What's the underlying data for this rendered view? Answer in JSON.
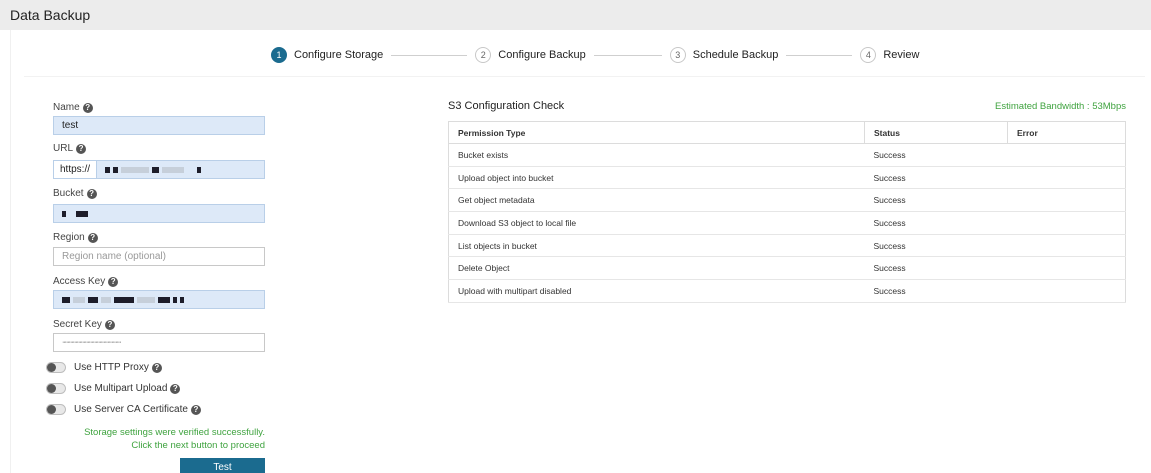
{
  "page": {
    "title": "Data Backup"
  },
  "stepper": {
    "steps": [
      {
        "num": "1",
        "label": "Configure Storage",
        "active": true
      },
      {
        "num": "2",
        "label": "Configure Backup",
        "active": false
      },
      {
        "num": "3",
        "label": "Schedule Backup",
        "active": false
      },
      {
        "num": "4",
        "label": "Review",
        "active": false
      }
    ]
  },
  "form": {
    "name": {
      "label": "Name",
      "value": "test"
    },
    "url": {
      "label": "URL",
      "prefix": "https://"
    },
    "bucket": {
      "label": "Bucket"
    },
    "region": {
      "label": "Region",
      "placeholder": "Region name (optional)"
    },
    "access_key": {
      "label": "Access Key"
    },
    "secret_key": {
      "label": "Secret Key",
      "value": "············································"
    },
    "toggles": {
      "http_proxy": "Use HTTP Proxy",
      "multipart": "Use Multipart Upload",
      "server_ca": "Use Server CA Certificate"
    },
    "success_line1": "Storage settings were verified successfully.",
    "success_line2": "Click the next button to proceed",
    "test_button": "Test"
  },
  "s3_check": {
    "title": "S3 Configuration Check",
    "bandwidth": "Estimated Bandwidth : 53Mbps",
    "headers": [
      "Permission Type",
      "Status",
      "Error"
    ],
    "rows": [
      {
        "type": "Bucket exists",
        "status": "Success",
        "error": ""
      },
      {
        "type": "Upload object into bucket",
        "status": "Success",
        "error": ""
      },
      {
        "type": "Get object metadata",
        "status": "Success",
        "error": ""
      },
      {
        "type": "Download S3 object to local file",
        "status": "Success",
        "error": ""
      },
      {
        "type": "List objects in bucket",
        "status": "Success",
        "error": ""
      },
      {
        "type": "Delete Object",
        "status": "Success",
        "error": ""
      },
      {
        "type": "Upload with multipart disabled",
        "status": "Success",
        "error": ""
      }
    ]
  },
  "colors": {
    "primary": "#1b6b8f",
    "success": "#3fa33f",
    "field_bg": "#dde9f8"
  },
  "icons": {
    "help": "question-circle-icon"
  }
}
